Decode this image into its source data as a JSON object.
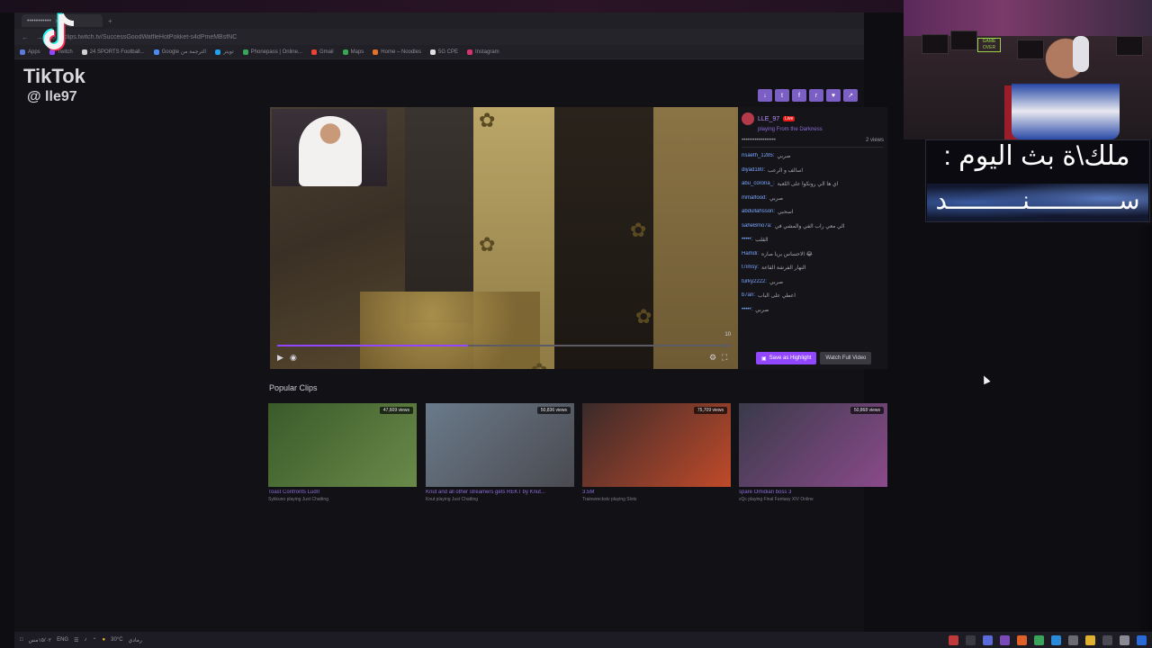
{
  "browser": {
    "tab_label": "•••••••••••",
    "tab_close": "×",
    "tab_new": "+",
    "url": "clips.twitch.tv/SuccessGoodWaffleHotPokket-s4dPmeMBsfNC",
    "bookmarks": [
      {
        "label": "Apps",
        "color": "#5b7bd8"
      },
      {
        "label": "Twitch",
        "color": "#9147ff"
      },
      {
        "label": "24 SPORTS Football...",
        "color": "#d0d0d0"
      },
      {
        "label": "Google الترجمة من",
        "color": "#4a8af4"
      },
      {
        "label": "تويتر",
        "color": "#1da1f2"
      },
      {
        "label": "Phonepass | Online...",
        "color": "#3aa55a"
      },
      {
        "label": "Gmail",
        "color": "#ea4335"
      },
      {
        "label": "Maps",
        "color": "#34a853"
      },
      {
        "label": "Home – Noodles",
        "color": "#e0702a"
      },
      {
        "label": "5G CPE",
        "color": "#e0e0e0"
      },
      {
        "label": "Instagram",
        "color": "#d6346e"
      }
    ]
  },
  "player": {
    "hdr": "10",
    "progress": 0.42
  },
  "share_icons": [
    "↓",
    "t",
    "f",
    "r",
    "♥",
    "↗"
  ],
  "chat": {
    "streamer": "LLE_97",
    "live": "Live",
    "playing": "playing From the Darkness",
    "views": "2 views",
    "views_prefix": "••••••••••••••••••",
    "messages": [
      {
        "user": "nsaeth_1285:",
        "text": "صربي"
      },
      {
        "user": "diyad180:",
        "text": "اسالف و الرعب"
      },
      {
        "user": "abu_corona_:",
        "text": "اي ها الي رونكوا على اللعبة"
      },
      {
        "user": "mmalfood:",
        "text": "صربي"
      },
      {
        "user": "abdullahsson:",
        "text": "اسحبي"
      },
      {
        "user": "saheBmo7a:",
        "text": "الي معي راب الفي والمشي في"
      },
      {
        "user": "•••••:",
        "text": "القلب"
      },
      {
        "user": "Hamdi:",
        "text": "الاحساس بريا صاره 😂"
      },
      {
        "user": "t7imsy:",
        "text": "النهار الفرشة القاعة"
      },
      {
        "user": "turky2222:",
        "text": "صربي"
      },
      {
        "user": "b7ari:",
        "text": "اعطي على الباب"
      },
      {
        "user": "•••••:",
        "text": "صربي"
      }
    ],
    "save_highlight": "Save as Highlight",
    "watch_full": "Watch Full Video"
  },
  "popular": {
    "title": "Popular Clips",
    "clips": [
      {
        "views": "47,609 views",
        "title": "Toast Confronts Lud0",
        "sub": "Sykkuno playing Just Chatting",
        "bg1": "#3a5a2a",
        "bg2": "#6a8a4a"
      },
      {
        "views": "50,836 views",
        "title": "Knut and all other streamers gets REKT by Knut...",
        "sub": "Knut playing Just Chatting",
        "bg1": "#6a7a8a",
        "bg2": "#4a4a50"
      },
      {
        "views": "75,709 views",
        "title": "3.5M",
        "sub": "Trainwreckstv playing Slots",
        "bg1": "#3a2a2a",
        "bg2": "#c04a2a"
      },
      {
        "views": "50,868 views",
        "title": "spare Omidian boss 3",
        "sub": "xQc playing Final Fantasy XIV Online",
        "bg1": "#3a3a4a",
        "bg2": "#8a4a8a"
      }
    ]
  },
  "tiktok": {
    "name": "TikTok",
    "handle": "@ lle97"
  },
  "webcam": {
    "gameover": "GAME OVER"
  },
  "overlay": {
    "title": "ملك\\ة بث اليوم :",
    "name": "ســــــــــــنــــــــــد"
  },
  "taskbar": {
    "date": "١٥/٠٢مس",
    "lang": "ENG",
    "weather": "رمادي",
    "temp": "30°C"
  }
}
